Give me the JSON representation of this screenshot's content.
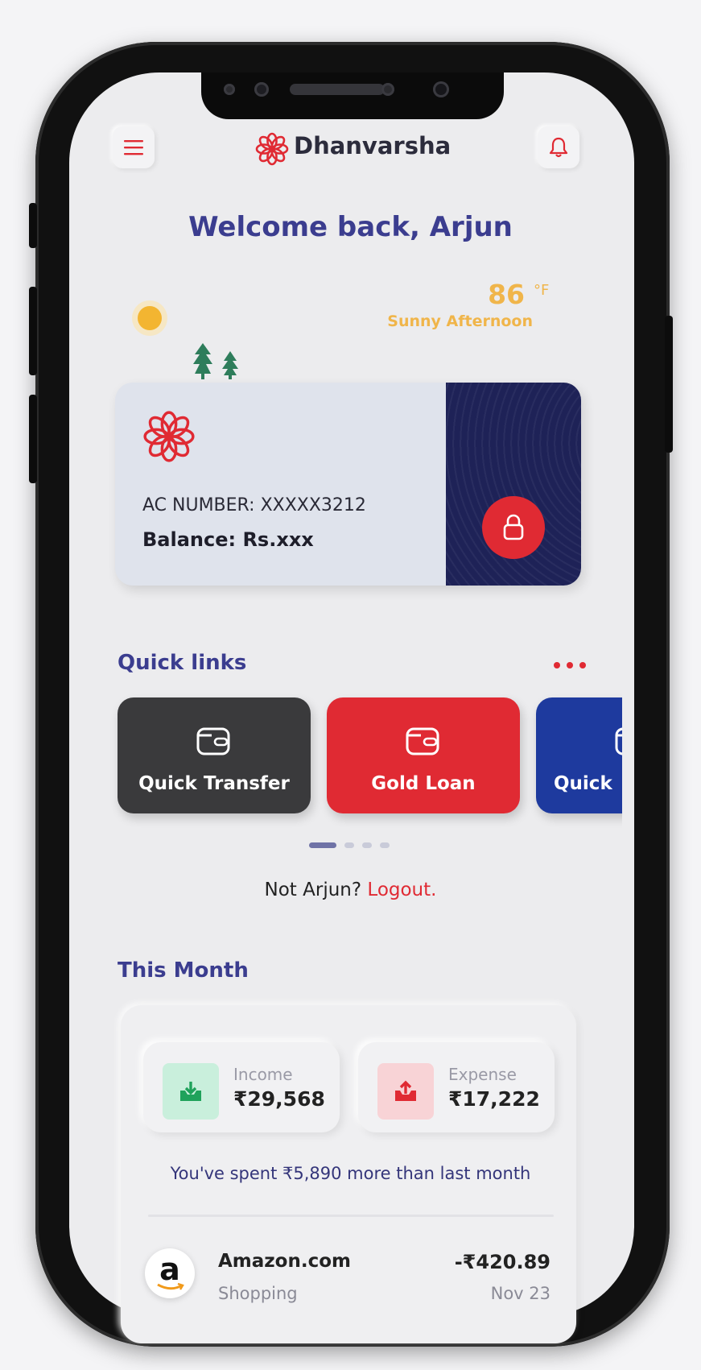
{
  "app": {
    "brand_name": "Dhanvarsha",
    "brand_color": "#e02a33",
    "accent_color": "#3b3d8f"
  },
  "header": {
    "menu_icon": "hamburger-menu-icon",
    "notification_icon": "bell-icon"
  },
  "welcome": "Welcome back, Arjun",
  "weather": {
    "temperature": "86",
    "unit": "°F",
    "condition": "Sunny Afternoon"
  },
  "account_card": {
    "account_number": "AC NUMBER: XXXXX3212",
    "balance": "Balance: Rs.xxx",
    "lock_icon": "lock-icon"
  },
  "quick_links": {
    "title": "Quick links",
    "more_icon": "more-dots-icon",
    "items": [
      {
        "label": "Quick Transfer",
        "color": "#3a3a3c",
        "icon": "wallet-icon"
      },
      {
        "label": "Gold Loan",
        "color": "#e02a33",
        "icon": "wallet-icon"
      },
      {
        "label": "Quick",
        "color": "#1e3a9e",
        "icon": "wallet-icon"
      }
    ],
    "page_count": 4,
    "active_page": 1
  },
  "logout": {
    "prompt": "Not Arjun?",
    "link": "Logout."
  },
  "this_month": {
    "title": "This Month",
    "income": {
      "label": "Income",
      "value": "₹29,568"
    },
    "expense": {
      "label": "Expense",
      "value": "₹17,222"
    },
    "note": "You've spent ₹5,890 more than last month",
    "transactions": [
      {
        "merchant": "Amazon.com",
        "category": "Shopping",
        "amount": "-₹420.89",
        "date": "Nov 23",
        "logo_letter": "a"
      }
    ]
  }
}
